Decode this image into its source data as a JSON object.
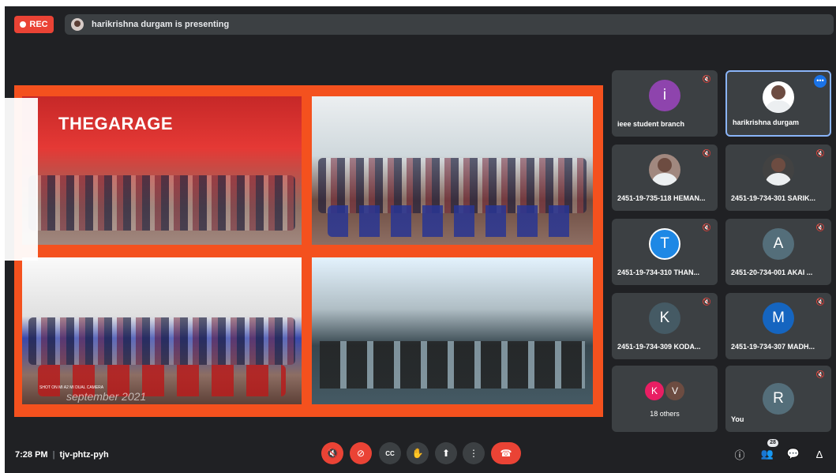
{
  "recording": {
    "label": "REC",
    "color": "#ea4335"
  },
  "presentation_banner": {
    "text": "harikrishna durgam is presenting"
  },
  "slide": {
    "sign_text": "THEGARAGE",
    "photo_tag": "SHOT ON MI A2\nMI DUAL CAMERA",
    "date_overlay": "september 2021"
  },
  "participants": [
    {
      "name": "ieee student branch",
      "initial": "i",
      "color": "#8e44ad",
      "muted": true
    },
    {
      "name": "harikrishna durgam",
      "initial": "",
      "color": "",
      "muted": false,
      "active": true
    },
    {
      "name": "2451-19-735-118 HEMAN...",
      "initial": "",
      "color": "",
      "muted": true
    },
    {
      "name": "2451-19-734-301 SARIK...",
      "initial": "",
      "color": "",
      "muted": true
    },
    {
      "name": "2451-19-734-310 THAN...",
      "initial": "T",
      "color": "#1e88e5",
      "muted": true
    },
    {
      "name": "2451-20-734-001 AKAI ...",
      "initial": "A",
      "color": "#546e7a",
      "muted": true
    },
    {
      "name": "2451-19-734-309 KODA...",
      "initial": "K",
      "color": "#455a64",
      "muted": true
    },
    {
      "name": "2451-19-734-307 MADH...",
      "initial": "M",
      "color": "#1565c0",
      "muted": true
    }
  ],
  "others": {
    "label": "18 others",
    "avatars": [
      {
        "initial": "K",
        "color": "#e91e63"
      },
      {
        "initial": "V",
        "color": "#6d4c41"
      }
    ]
  },
  "self": {
    "name": "You",
    "initial": "R",
    "color": "#546e7a",
    "muted": true
  },
  "footer": {
    "time": "7:28 PM",
    "meeting_code": "tjv-phtz-pyh",
    "people_count": "28"
  },
  "icons": {
    "mic_off": "🎙",
    "camera_off": "⊘",
    "cc": "CC",
    "hand": "✋",
    "present": "⬆",
    "more": "⋮",
    "hangup": "☎",
    "info": "ⓘ",
    "people": "👥",
    "chat": "💬",
    "activities": "∆"
  }
}
